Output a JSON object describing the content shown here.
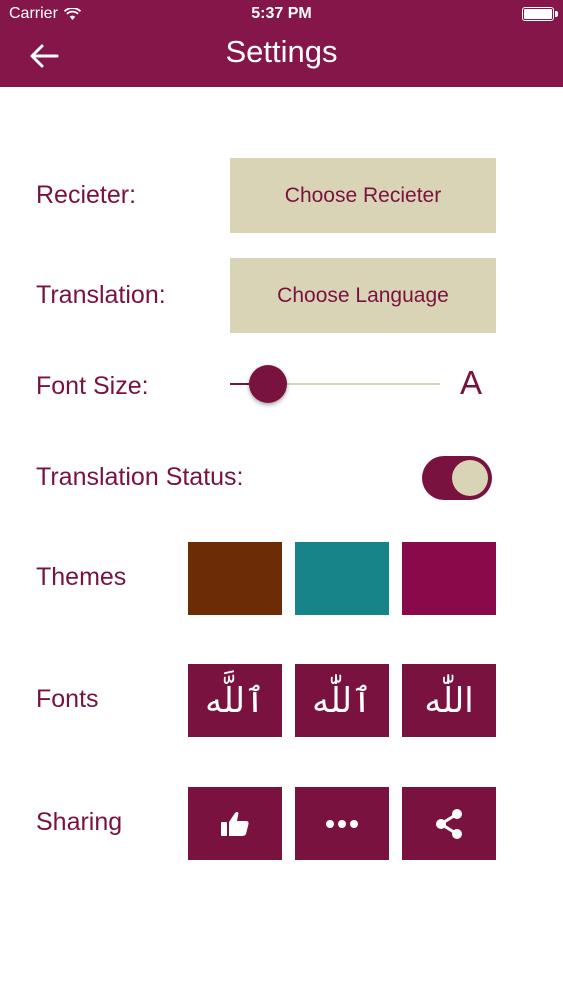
{
  "status_bar": {
    "carrier": "Carrier",
    "time": "5:37 PM"
  },
  "header": {
    "title": "Settings",
    "back_icon": "arrow-left-icon"
  },
  "reciter": {
    "label": "Recieter:",
    "button": "Choose Recieter"
  },
  "translation": {
    "label": "Translation:",
    "button": "Choose Language"
  },
  "font_size": {
    "label": "Font Size:",
    "value_fraction": 0.18,
    "glyph": "A"
  },
  "translation_status": {
    "label": "Translation Status:",
    "enabled": true
  },
  "themes": {
    "label": "Themes",
    "colors": [
      "#6b2c06",
      "#17848a",
      "#880a4a"
    ]
  },
  "fonts": {
    "label": "Fonts",
    "samples": [
      "ٱللَّه",
      "ٱللّٰه",
      "اللّٰه"
    ]
  },
  "sharing": {
    "label": "Sharing",
    "icons": [
      "thumbs-up-icon",
      "more-dots-icon",
      "share-icon"
    ]
  },
  "colors": {
    "primary": "#7a1240",
    "header": "#85164a",
    "accent_beige": "#d9d4b6"
  }
}
